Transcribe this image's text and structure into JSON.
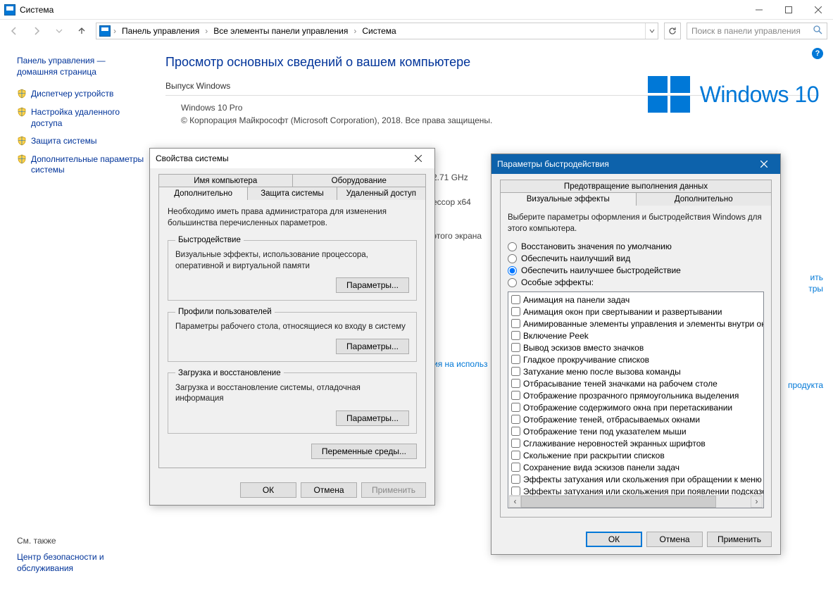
{
  "window": {
    "title": "Система"
  },
  "breadcrumb": {
    "0": "Панель управления",
    "1": "Все элементы панели управления",
    "2": "Система"
  },
  "search": {
    "placeholder": "Поиск в панели управления"
  },
  "sidebar": {
    "home1": "Панель управления —",
    "home2": "домашняя страница",
    "items": {
      "0": "Диспетчер устройств",
      "1": "Настройка удаленного доступа",
      "2": "Защита системы",
      "3": "Дополнительные параметры системы"
    },
    "see_also_label": "См. также",
    "see_also_link": "Центр безопасности и обслуживания"
  },
  "content": {
    "heading": "Просмотр основных сведений о вашем компьютере",
    "edition_label": "Выпуск Windows",
    "edition_value": "Windows 10 Pro",
    "copyright": "© Корпорация Майкрософт (Microsoft Corporation), 2018. Все права защищены.",
    "win10_text": "Windows 10",
    "partial_ghz": "2.71 GHz",
    "partial_arch": "ессор x64",
    "partial_screen": "этого экрана",
    "partial_link1a": "ить",
    "partial_link1b": "тры",
    "partial_terms": "ия на использ",
    "partial_product": "продукта"
  },
  "sysprop": {
    "title": "Свойства системы",
    "tabs": {
      "row1": {
        "0": "Имя компьютера",
        "1": "Оборудование"
      },
      "row2": {
        "0": "Дополнительно",
        "1": "Защита системы",
        "2": "Удаленный доступ"
      }
    },
    "admin_note": "Необходимо иметь права администратора для изменения большинства перечисленных параметров.",
    "perf": {
      "legend": "Быстродействие",
      "desc": "Визуальные эффекты, использование процессора, оперативной и виртуальной памяти",
      "btn": "Параметры..."
    },
    "profiles": {
      "legend": "Профили пользователей",
      "desc": "Параметры рабочего стола, относящиеся ко входу в систему",
      "btn": "Параметры..."
    },
    "startup": {
      "legend": "Загрузка и восстановление",
      "desc": "Загрузка и восстановление системы, отладочная информация",
      "btn": "Параметры..."
    },
    "env_btn": "Переменные среды...",
    "ok": "ОК",
    "cancel": "Отмена",
    "apply": "Применить"
  },
  "perf_opts": {
    "title": "Параметры быстродействия",
    "tabs": {
      "0": "Визуальные эффекты",
      "1": "Дополнительно",
      "2": "Предотвращение выполнения данных"
    },
    "intro": "Выберите параметры оформления и быстродействия Windows для этого компьютера.",
    "radios": {
      "0": "Восстановить значения по умолчанию",
      "1": "Обеспечить наилучший вид",
      "2": "Обеспечить наилучшее быстродействие",
      "3": "Особые эффекты:"
    },
    "checks": {
      "0": "Анимация на панели задач",
      "1": "Анимация окон при свертывании и развертывании",
      "2": "Анимированные элементы управления и элементы внутри окн",
      "3": "Включение Peek",
      "4": "Вывод эскизов вместо значков",
      "5": "Гладкое прокручивание списков",
      "6": "Затухание меню после вызова команды",
      "7": "Отбрасывание теней значками на рабочем столе",
      "8": "Отображение прозрачного прямоугольника выделения",
      "9": "Отображение содержимого окна при перетаскивании",
      "10": "Отображение теней, отбрасываемых окнами",
      "11": "Отображение тени под указателем мыши",
      "12": "Сглаживание неровностей экранных шрифтов",
      "13": "Скольжение при раскрытии списков",
      "14": "Сохранение вида эскизов панели задач",
      "15": "Эффекты затухания или скольжения при обращении к меню",
      "16": "Эффекты затухания или скольжения при появлении подсказок"
    },
    "ok": "ОК",
    "cancel": "Отмена",
    "apply": "Применить"
  }
}
